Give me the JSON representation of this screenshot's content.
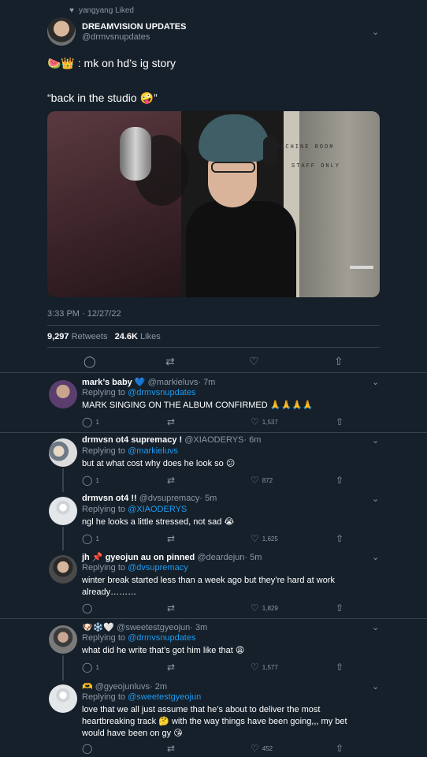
{
  "social_context": "yangyang Liked",
  "main": {
    "name": "DREAMVISION UPDATES",
    "handle": "@drmvsnupdates",
    "text1": "🍉👑 : mk on hd’s ig story",
    "text2": "“back in the studio 🤪”",
    "photo_sign_1": "MACHINE ROOM",
    "photo_sign_2": "STAFF ONLY",
    "timestamp": "3:33 PM · 12/27/22",
    "retweets_count": "9,297",
    "retweets_label": "Retweets",
    "likes_count": "24.6K",
    "likes_label": "Likes"
  },
  "replies": [
    {
      "name": "mark’s baby 💙",
      "handle": "@markieluvs",
      "time": "· 7m",
      "replying_prefix": "Replying to",
      "replying_to": "@drmvsnupdates",
      "text": "MARK SINGING ON THE ALBUM CONFIRMED 🙏🙏🙏🙏",
      "replies": "1",
      "likes": "1,537"
    },
    {
      "name": "drmvsn ot4 supremacy !",
      "handle": "@XIAODERYS",
      "time": "· 6m",
      "replying_prefix": "Replying to",
      "replying_to": "@markieluvs",
      "text": "but at what cost why does he look so 😕",
      "replies": "1",
      "likes": "872"
    },
    {
      "name": "drmvsn ot4 !!",
      "handle": "@dvsupremacy",
      "time": "· 5m",
      "replying_prefix": "Replying to",
      "replying_to": "@XIAODERYS",
      "text": "ngl he looks a little stressed, not sad 😭",
      "replies": "1",
      "likes": "1,625"
    },
    {
      "name": "jh 📌 gyeojun au on pinned",
      "handle": "@deardejun",
      "time": "· 5m",
      "replying_prefix": "Replying to",
      "replying_to": "@dvsupremacy",
      "text": "winter break started less than a week ago but they’re hard at work already………",
      "replies": "",
      "likes": "1,829"
    },
    {
      "name": "🐶❄️🤍",
      "handle": "@sweetestgyeojun",
      "time": "· 3m",
      "replying_prefix": "Replying to",
      "replying_to": "@drmvsnupdates",
      "text": "what did he write that’s got him like that 😩",
      "replies": "1",
      "likes": "1,577"
    },
    {
      "name": "🫶",
      "handle": "@gyeojunluvs",
      "time": "· 2m",
      "replying_prefix": "Replying to",
      "replying_to": "@sweetestgyeojun",
      "text": "love that we all just assume that he’s about to deliver the most heartbreaking track 🤔 with the way things have been going,,, my bet would have been on gy 😘",
      "replies": "",
      "likes": "452"
    }
  ],
  "colors": {
    "background": "#15202b",
    "link": "#1d9bf0",
    "muted": "#8b98a5",
    "divider": "#38444d"
  },
  "icons": {
    "reply": "reply-icon",
    "retweet": "retweet-icon",
    "like": "heart-icon",
    "share": "share-icon",
    "more": "chevron-down-icon"
  }
}
